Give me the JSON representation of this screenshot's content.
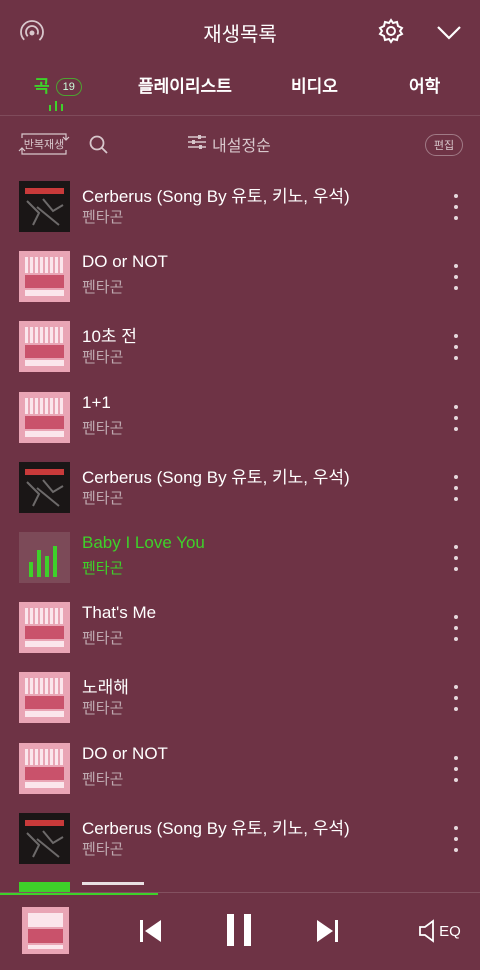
{
  "header": {
    "title": "재생목록"
  },
  "tabs": [
    {
      "label": "곡",
      "badge": "19"
    },
    {
      "label": "플레이리스트"
    },
    {
      "label": "비디오"
    },
    {
      "label": "어학"
    }
  ],
  "toolbar": {
    "repeat_label": "반복재생",
    "sort_label": "내설정순",
    "edit_label": "편집"
  },
  "songs": [
    {
      "title": "Cerberus (Song By 유토, 키노, 우석)",
      "artist": "펜타곤",
      "art": "dark"
    },
    {
      "title": "DO or NOT",
      "artist": "펜타곤",
      "art": "pink"
    },
    {
      "title": "10초 전",
      "artist": "펜타곤",
      "art": "pink"
    },
    {
      "title": "1+1",
      "artist": "펜타곤",
      "art": "pink"
    },
    {
      "title": "Cerberus (Song By 유토, 키노, 우석)",
      "artist": "펜타곤",
      "art": "dark"
    },
    {
      "title": "Baby I Love You",
      "artist": "펜타곤",
      "art": "playing"
    },
    {
      "title": "That's Me",
      "artist": "펜타곤",
      "art": "pink"
    },
    {
      "title": "노래해",
      "artist": "펜타곤",
      "art": "pink"
    },
    {
      "title": "DO or NOT",
      "artist": "펜타곤",
      "art": "pink"
    },
    {
      "title": "Cerberus (Song By 유토, 키노, 우석)",
      "artist": "펜타곤",
      "art": "dark"
    }
  ],
  "player": {
    "eq_label": "EQ",
    "progress": 0.33
  },
  "colors": {
    "background": "#6e3345",
    "accent": "#3ed12a",
    "muted_text": "#bfa9b0"
  }
}
